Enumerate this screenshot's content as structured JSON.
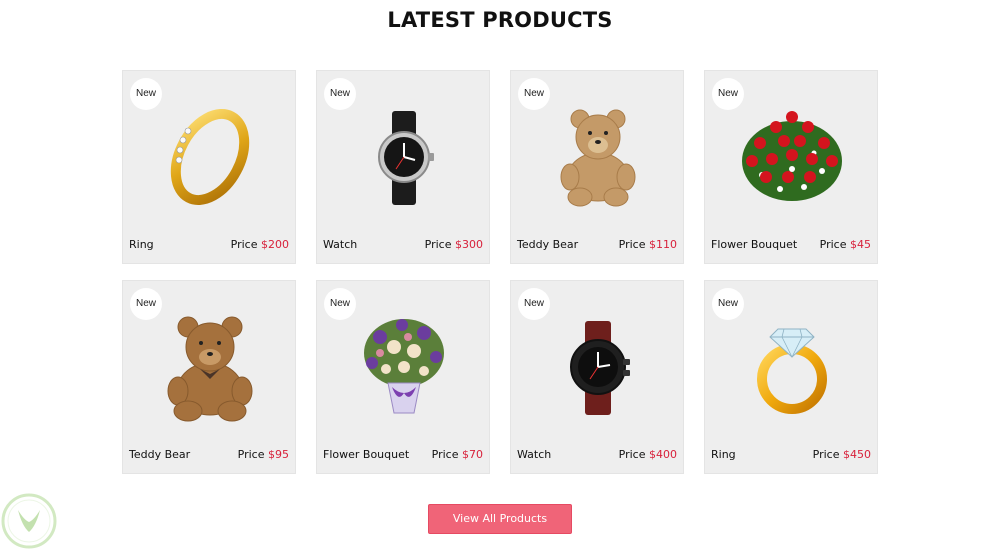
{
  "section": {
    "title": "LATEST PRODUCTS"
  },
  "badge_label": "New",
  "price_prefix": "Price",
  "products": [
    {
      "name": "Ring",
      "price": "$200",
      "icon": "gold-ring-icon"
    },
    {
      "name": "Watch",
      "price": "$300",
      "icon": "watch-icon"
    },
    {
      "name": "Teddy Bear",
      "price": "$110",
      "icon": "teddy-bear-icon"
    },
    {
      "name": "Flower Bouquet",
      "price": "$45",
      "icon": "rose-bouquet-icon"
    },
    {
      "name": "Teddy Bear",
      "price": "$95",
      "icon": "teddy-bear-icon"
    },
    {
      "name": "Flower Bouquet",
      "price": "$70",
      "icon": "flower-vase-icon"
    },
    {
      "name": "Watch",
      "price": "$400",
      "icon": "watch-icon"
    },
    {
      "name": "Ring",
      "price": "$450",
      "icon": "diamond-ring-icon"
    }
  ],
  "view_all_label": "View All Products",
  "colors": {
    "accent": "#f06478",
    "price": "#d8213b",
    "card_bg": "#eeeeee"
  }
}
